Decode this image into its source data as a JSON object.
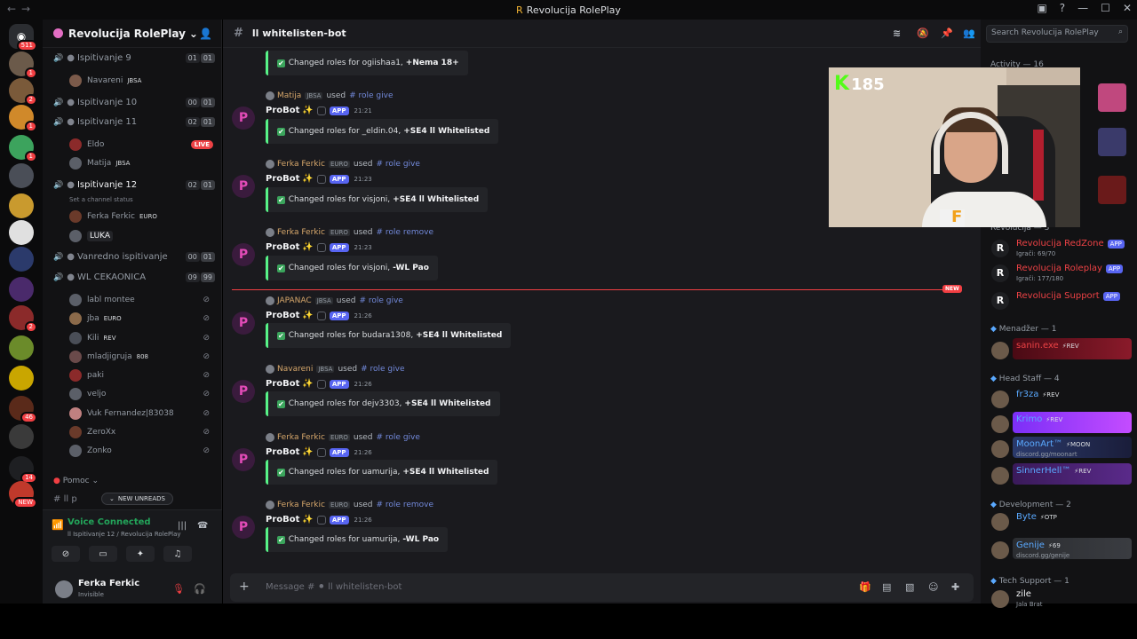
{
  "window": {
    "title": "Revolucija RolePlay"
  },
  "server_list": {
    "top_badge": "511",
    "servers": [
      {
        "color": "#2b2d31",
        "badge": ""
      },
      {
        "color": "#6b5a4a",
        "badge": "1"
      },
      {
        "color": "#7a5a3a",
        "badge": "2"
      },
      {
        "color": "#d0892a",
        "badge": "1"
      },
      {
        "color": "#3ca35d",
        "badge": "1"
      },
      {
        "color": "#4a4e57",
        "badge": ""
      },
      {
        "color": "#c99a2e",
        "badge": ""
      },
      {
        "color": "#e0e0e0",
        "badge": ""
      },
      {
        "color": "#2b3a6b",
        "badge": ""
      },
      {
        "color": "#4a2a6b",
        "badge": ""
      },
      {
        "color": "#8b2a2a",
        "badge": "2"
      },
      {
        "color": "#6b8b2a",
        "badge": ""
      },
      {
        "color": "#c9a600",
        "badge": ""
      },
      {
        "color": "#5a2a1a",
        "badge": "46"
      },
      {
        "color": "#3a3a3a",
        "badge": ""
      },
      {
        "color": "#1e1f22",
        "badge": "14"
      },
      {
        "color": "#c0392b",
        "badge": "NEW"
      }
    ]
  },
  "sidebar": {
    "server_name": "Revolucija RolePlay",
    "voice_channels": [
      {
        "name": "Ispitivanje 9",
        "c1": "01",
        "c2": "01",
        "members": [
          {
            "name": "Navareni",
            "tag": "JBSA"
          }
        ]
      },
      {
        "name": "Ispitivanje 10",
        "c1": "00",
        "c2": "01",
        "members": []
      },
      {
        "name": "Ispitivanje 11",
        "c1": "02",
        "c2": "01",
        "members": [
          {
            "name": "Eldo",
            "live": "LIVE"
          },
          {
            "name": "Matija",
            "tag": "JBSA"
          }
        ]
      },
      {
        "name": "Ispitivanje 12",
        "c1": "02",
        "c2": "01",
        "status": "Set a channel status",
        "members": [
          {
            "name": "Ferka Ferkic",
            "tag": "EURO"
          },
          {
            "name": "LUKA"
          }
        ]
      },
      {
        "name": "Vanredno ispitivanje",
        "c1": "00",
        "c2": "01",
        "members": []
      },
      {
        "name": "WL CEKAONICA",
        "c1": "09",
        "c2": "99",
        "members": [
          {
            "name": "labl montee"
          },
          {
            "name": "jba",
            "tag": "EURO"
          },
          {
            "name": "Kili",
            "tag": "REV"
          },
          {
            "name": "mladjigruja",
            "tag": "808"
          },
          {
            "name": "paki"
          },
          {
            "name": "veljo"
          },
          {
            "name": "Vuk Fernandez|83038"
          },
          {
            "name": "ZeroXx"
          },
          {
            "name": "Zonko"
          }
        ]
      }
    ],
    "category": "Pomoc",
    "partial_channel": "ll p",
    "new_unreads": "NEW UNREADS",
    "voice": {
      "status": "Voice Connected",
      "channel": "ll Ispitivanje 12 / Revolucija RolePlay"
    },
    "user": {
      "name": "Ferka Ferkic",
      "status": "Invisible"
    }
  },
  "channel": {
    "name": "ll whitelisten-bot",
    "placeholder": "Message # ⚫ ll whitelisten-bot"
  },
  "messages": [
    {
      "embed_pre": "Changed roles for ogiishaa1,",
      "embed_bold": "+Nema 18+"
    },
    {
      "user": "Matija",
      "user_tag": "JBSA",
      "cmd": "role give",
      "bot": "ProBot",
      "time": "21:21",
      "embed_pre": "Changed roles for _eldin.04,",
      "embed_bold": "+SE4 ll Whitelisted"
    },
    {
      "user": "Ferka Ferkic",
      "user_tag": "EURO",
      "cmd": "role give",
      "bot": "ProBot",
      "time": "21:23",
      "embed_pre": "Changed roles for visjoni,",
      "embed_bold": "+SE4 ll Whitelisted"
    },
    {
      "user": "Ferka Ferkic",
      "user_tag": "EURO",
      "cmd": "role remove",
      "bot": "ProBot",
      "time": "21:23",
      "embed_pre": "Changed roles for visjoni,",
      "embed_bold": "-WL Pao"
    },
    {
      "user": "JAPANAC",
      "user_tag": "JBSA",
      "cmd": "role give",
      "bot": "ProBot",
      "time": "21:26",
      "embed_pre": "Changed roles for budara1308,",
      "embed_bold": "+SE4 ll Whitelisted"
    },
    {
      "user": "Navareni",
      "user_tag": "JBSA",
      "cmd": "role give",
      "bot": "ProBot",
      "time": "21:26",
      "embed_pre": "Changed roles for dejv3303,",
      "embed_bold": "+SE4 ll Whitelisted"
    },
    {
      "user": "Ferka Ferkic",
      "user_tag": "EURO",
      "cmd": "role give",
      "bot": "ProBot",
      "time": "21:26",
      "embed_pre": "Changed roles for uamurija,",
      "embed_bold": "+SE4 ll Whitelisted"
    },
    {
      "user": "Ferka Ferkic",
      "user_tag": "EURO",
      "cmd": "role remove",
      "bot": "ProBot",
      "time": "21:26",
      "embed_pre": "Changed roles for uamurija,",
      "embed_bold": "-WL Pao"
    }
  ],
  "used_word": "used",
  "app_label": "APP",
  "new_marker": "NEW",
  "webcam": {
    "kick_count": "185"
  },
  "members_panel": {
    "search_placeholder": "Search Revolucija RolePlay",
    "activity": "Activity — 16",
    "revolucija_group": "Revolucija — 3",
    "bots": [
      {
        "name": "Revolucija RedZone",
        "status": "Igrači: 69/70",
        "color": "#ed4245"
      },
      {
        "name": "Revolucija Roleplay",
        "status": "Igrači: 177/180",
        "color": "#ed4245"
      },
      {
        "name": "Revolucija Support",
        "status": "",
        "color": "#ed4245"
      }
    ],
    "groups": [
      {
        "title": "Menadžer — 1",
        "members": [
          {
            "name": "sanin.exe",
            "tag": "REV",
            "color": "#ed4245",
            "status": ""
          }
        ]
      },
      {
        "title": "Head Staff — 4",
        "members": [
          {
            "name": "fr3za",
            "tag": "REV",
            "color": "#5aa9ff",
            "status": ""
          },
          {
            "name": "Krimo",
            "tag": "REV",
            "color": "#5aa9ff",
            "status": ""
          },
          {
            "name": "MoonArt™",
            "tag": "MOON",
            "color": "#5aa9ff",
            "status": "discord.gg/moonart"
          },
          {
            "name": "SinnerHell™",
            "tag": "REV",
            "color": "#5aa9ff",
            "status": ""
          }
        ]
      },
      {
        "title": "Development — 2",
        "members": [
          {
            "name": "Byte",
            "tag": "OTP",
            "color": "#5aa9ff",
            "status": ""
          },
          {
            "name": "Genije",
            "tag": "69",
            "color": "#5aa9ff",
            "status": "discord.gg/genije"
          }
        ]
      },
      {
        "title": "Tech Support — 1",
        "members": [
          {
            "name": "zile",
            "tag": "",
            "color": "#f2f3f5",
            "status": "Jala Brat"
          }
        ]
      }
    ]
  }
}
